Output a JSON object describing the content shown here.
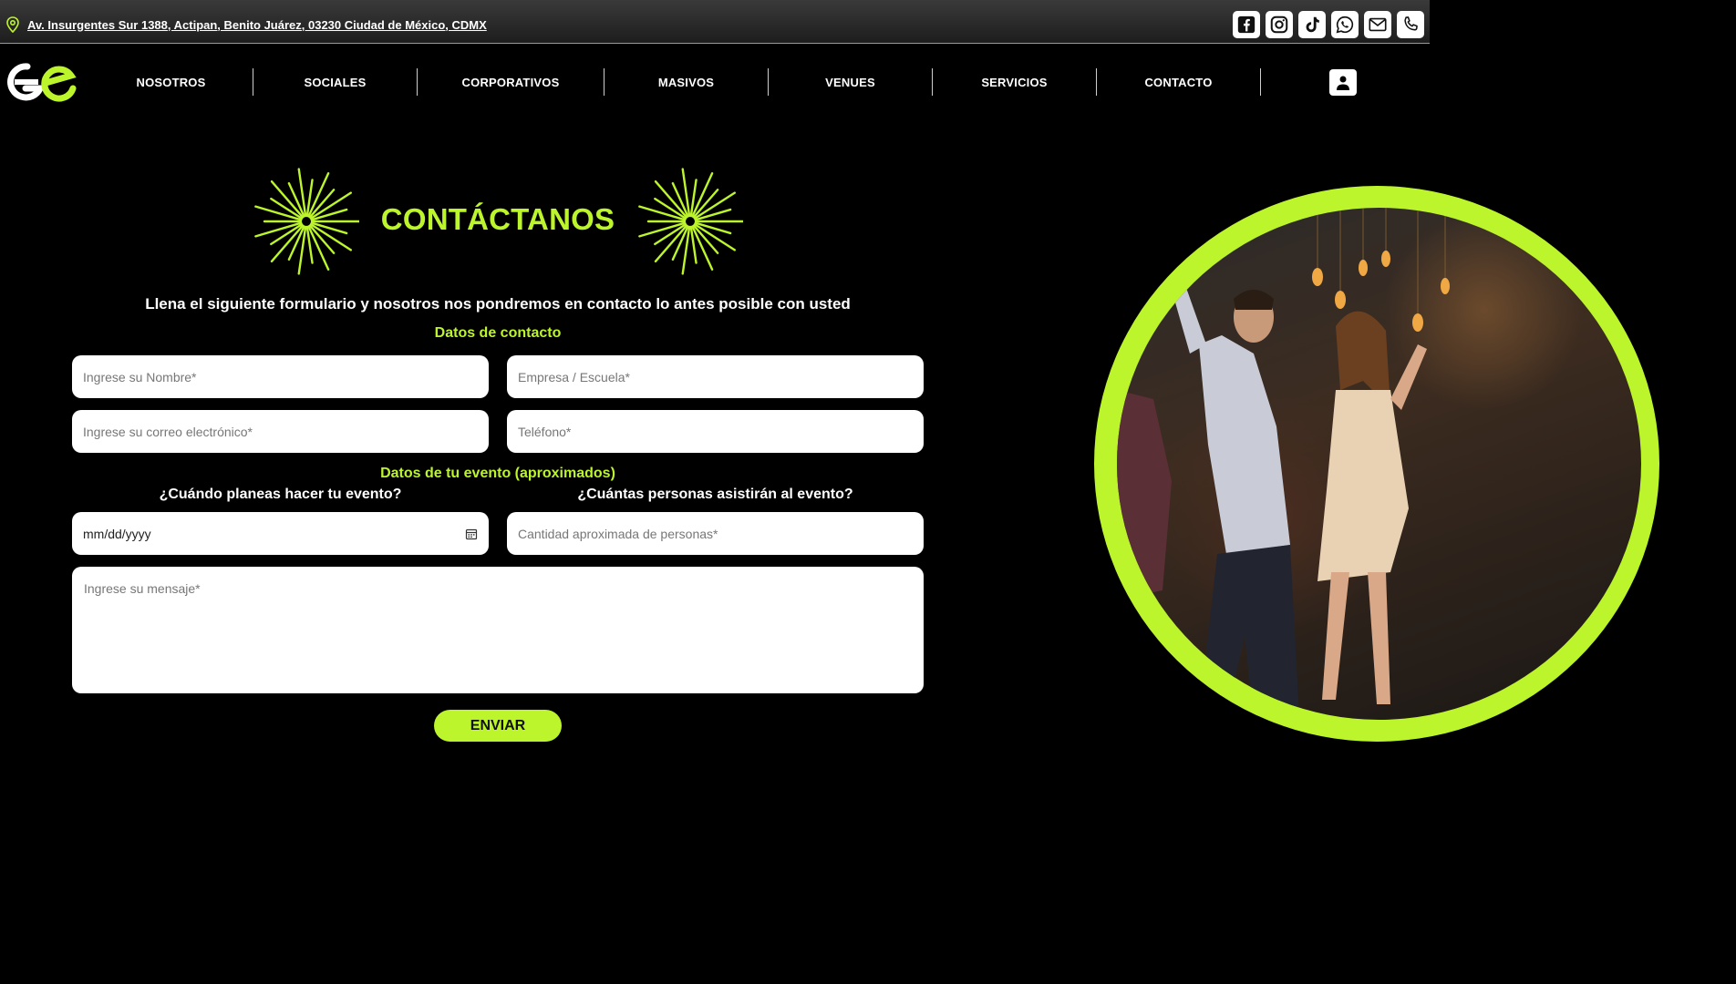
{
  "topbar": {
    "address": "Av. Insurgentes Sur 1388, Actipan, Benito Juárez, 03230 Ciudad de México, CDMX",
    "socials": [
      "facebook-icon",
      "instagram-icon",
      "tiktok-icon",
      "whatsapp-icon",
      "email-icon",
      "phone-icon"
    ]
  },
  "nav": {
    "items": [
      {
        "label": "NOSOTROS"
      },
      {
        "label": "SOCIALES"
      },
      {
        "label": "CORPORATIVOS"
      },
      {
        "label": "MASIVOS"
      },
      {
        "label": "VENUES"
      },
      {
        "label": "SERVICIOS"
      },
      {
        "label": "CONTACTO"
      }
    ]
  },
  "hero": {
    "title": "CONTÁCTANOS",
    "subtitle": "Llena el siguiente formulario y nosotros nos pondremos en contacto lo antes posible con usted"
  },
  "form": {
    "contact_section": "Datos de contacto",
    "name_placeholder": "Ingrese su Nombre*",
    "company_placeholder": "Empresa / Escuela*",
    "email_placeholder": "Ingrese su correo electrónico*",
    "phone_placeholder": "Teléfono*",
    "event_section": "Datos de tu evento (aproximados)",
    "date_question": "¿Cuándo planeas hacer tu evento?",
    "date_value": "mm/dd/yyyy",
    "people_question": "¿Cuántas personas asistirán al evento?",
    "people_placeholder": "Cantidad aproximada de personas*",
    "message_placeholder": "Ingrese su mensaje*",
    "submit_label": "ENVIAR"
  },
  "colors": {
    "accent": "#bdf52c",
    "background": "#000000"
  }
}
